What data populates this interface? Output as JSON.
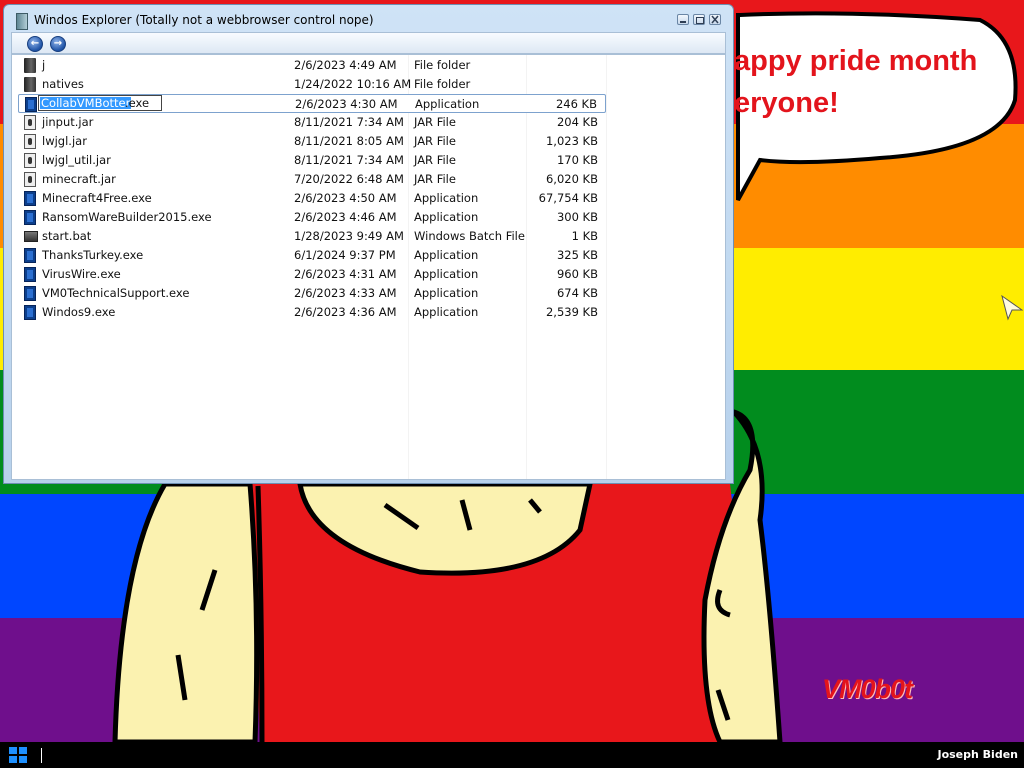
{
  "desktop": {
    "stripe_colors": [
      "#e8171b",
      "#ff8c00",
      "#ffed00",
      "#018c1e",
      "#0046ff",
      "#6f0f8c"
    ],
    "speech_bubble_text": "appy pride month\neryone!",
    "signature": "VM0b0t"
  },
  "window": {
    "title": "Windos Explorer (Totally not a webbrowser control nope)",
    "title_buttons": [
      "minimize-icon",
      "maximize-icon",
      "close-icon"
    ],
    "nav": {
      "back_icon": "back-arrow-icon",
      "forward_icon": "forward-arrow-icon"
    },
    "rename": {
      "selected_text": "CollabVMBotter",
      "extension": ".exe"
    },
    "files": [
      {
        "name": "j",
        "date": "2/6/2023 4:49 AM",
        "type": "File folder",
        "size": "",
        "icon": "folder-icon"
      },
      {
        "name": "natives",
        "date": "1/24/2022 10:16 AM",
        "type": "File folder",
        "size": "",
        "icon": "folder-icon"
      },
      {
        "name": "CollabVMBotter.exe",
        "date": "2/6/2023 4:30 AM",
        "type": "Application",
        "size": "246 KB",
        "icon": "application-icon"
      },
      {
        "name": "jinput.jar",
        "date": "8/11/2021 7:34 AM",
        "type": "JAR File",
        "size": "204 KB",
        "icon": "jar-file-icon"
      },
      {
        "name": "lwjgl.jar",
        "date": "8/11/2021 8:05 AM",
        "type": "JAR File",
        "size": "1,023 KB",
        "icon": "jar-file-icon"
      },
      {
        "name": "lwjgl_util.jar",
        "date": "8/11/2021 7:34 AM",
        "type": "JAR File",
        "size": "170 KB",
        "icon": "jar-file-icon"
      },
      {
        "name": "minecraft.jar",
        "date": "7/20/2022 6:48 AM",
        "type": "JAR File",
        "size": "6,020 KB",
        "icon": "jar-file-icon"
      },
      {
        "name": "Minecraft4Free.exe",
        "date": "2/6/2023 4:50 AM",
        "type": "Application",
        "size": "67,754 KB",
        "icon": "application-icon"
      },
      {
        "name": "RansomWareBuilder2015.exe",
        "date": "2/6/2023 4:46 AM",
        "type": "Application",
        "size": "300 KB",
        "icon": "application-icon"
      },
      {
        "name": "start.bat",
        "date": "1/28/2023 9:49 AM",
        "type": "Windows Batch File",
        "size": "1 KB",
        "icon": "batch-file-icon"
      },
      {
        "name": "ThanksTurkey.exe",
        "date": "6/1/2024 9:37 PM",
        "type": "Application",
        "size": "325 KB",
        "icon": "application-icon"
      },
      {
        "name": "VirusWire.exe",
        "date": "2/6/2023 4:31 AM",
        "type": "Application",
        "size": "960 KB",
        "icon": "application-icon"
      },
      {
        "name": "VM0TechnicalSupport.exe",
        "date": "2/6/2023 4:33 AM",
        "type": "Application",
        "size": "674 KB",
        "icon": "application-icon"
      },
      {
        "name": "Windos9.exe",
        "date": "2/6/2023 4:36 AM",
        "type": "Application",
        "size": "2,539 KB",
        "icon": "application-icon"
      }
    ],
    "selected_index": 2
  },
  "taskbar": {
    "start_icon": "windows-logo-icon",
    "user_name": "Joseph Biden"
  }
}
